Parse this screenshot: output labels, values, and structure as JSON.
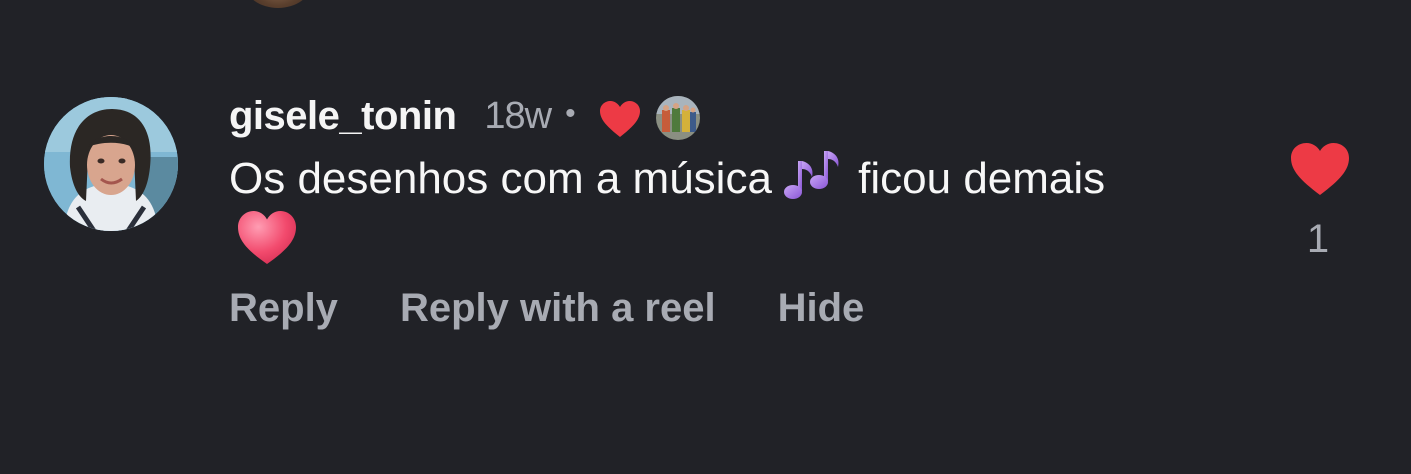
{
  "comment": {
    "username": "gisele_tonin",
    "time": "18w",
    "separator": "•",
    "text_part1": "Os desenhos com a música",
    "text_part2": "ficou demais",
    "liked_by_author": true
  },
  "actions": {
    "reply": "Reply",
    "reply_with_reel": "Reply with a reel",
    "hide": "Hide"
  },
  "likes": {
    "count": "1",
    "liked": true
  },
  "colors": {
    "background": "#212227",
    "text": "#f5f5f5",
    "secondary_text": "#a8abb3",
    "heart": "#ed3a45"
  },
  "icons": {
    "author_like": "red-heart-icon",
    "like": "heart-icon",
    "emoji_1": "musical-notes-emoji",
    "emoji_2": "pink-heart-emoji"
  }
}
